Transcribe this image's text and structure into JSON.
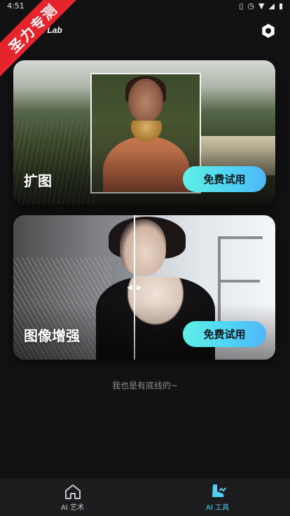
{
  "status_bar": {
    "time": "4:51",
    "icons": [
      "vibrate-icon",
      "alarm-icon",
      "wifi-icon",
      "signal-icon",
      "battery-icon"
    ]
  },
  "ribbon": {
    "text": "圣力专测"
  },
  "header": {
    "title": "t Lab",
    "settings_icon": "settings-icon"
  },
  "cards": [
    {
      "title": "扩图",
      "button_label": "免费试用"
    },
    {
      "title": "图像增强",
      "button_label": "免费试用"
    }
  ],
  "footer_note": "我也是有底线的~",
  "tab_bar": {
    "items": [
      {
        "label": "AI 艺术",
        "icon": "home-icon",
        "active": false
      },
      {
        "label": "AI 工具",
        "icon": "tools-icon",
        "active": true
      }
    ]
  },
  "colors": {
    "background": "#121214",
    "accent": "#4fd1f5",
    "accent_start": "#5ff0e6",
    "ribbon": "#e5242b",
    "tab_bar": "#1c1c1f"
  }
}
